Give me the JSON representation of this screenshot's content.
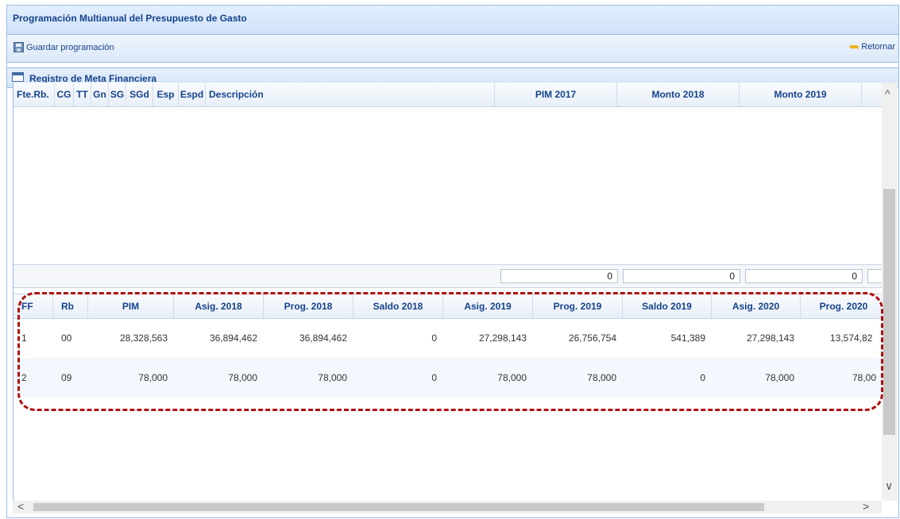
{
  "window": {
    "title": "Programación Multianual del Presupuesto de Gasto"
  },
  "toolbar": {
    "save_label": "Guardar programación",
    "back_label": "Retornar"
  },
  "panel": {
    "title": "Registro de Meta Financiera"
  },
  "grid1": {
    "headers": [
      "Fte.Rb.",
      "CG",
      "TT",
      "Gn",
      "SG",
      "SGd",
      "Esp",
      "Espd",
      "Descripción",
      "PIM 2017",
      "Monto 2018",
      "Monto 2019"
    ],
    "totals": [
      "0",
      "0",
      "0"
    ]
  },
  "grid2": {
    "headers": [
      "FF",
      "Rb",
      "PIM",
      "Asig. 2018",
      "Prog. 2018",
      "Saldo 2018",
      "Asig. 2019",
      "Prog. 2019",
      "Saldo 2019",
      "Asig. 2020",
      "Prog. 2020"
    ],
    "rows": [
      [
        "1",
        "00",
        "28,328,563",
        "36,894,462",
        "36,894,462",
        "0",
        "27,298,143",
        "26,756,754",
        "541,389",
        "27,298,143",
        "13,574,82"
      ],
      [
        "2",
        "09",
        "78,000",
        "78,000",
        "78,000",
        "0",
        "78,000",
        "78,000",
        "0",
        "78,000",
        "78,00"
      ]
    ]
  },
  "scroll": {
    "up": "^",
    "down": "∨",
    "left": "<",
    "right": ">"
  },
  "colors": {
    "header_text": "#15428b",
    "border": "#99bbe8",
    "highlight": "#b01010"
  }
}
